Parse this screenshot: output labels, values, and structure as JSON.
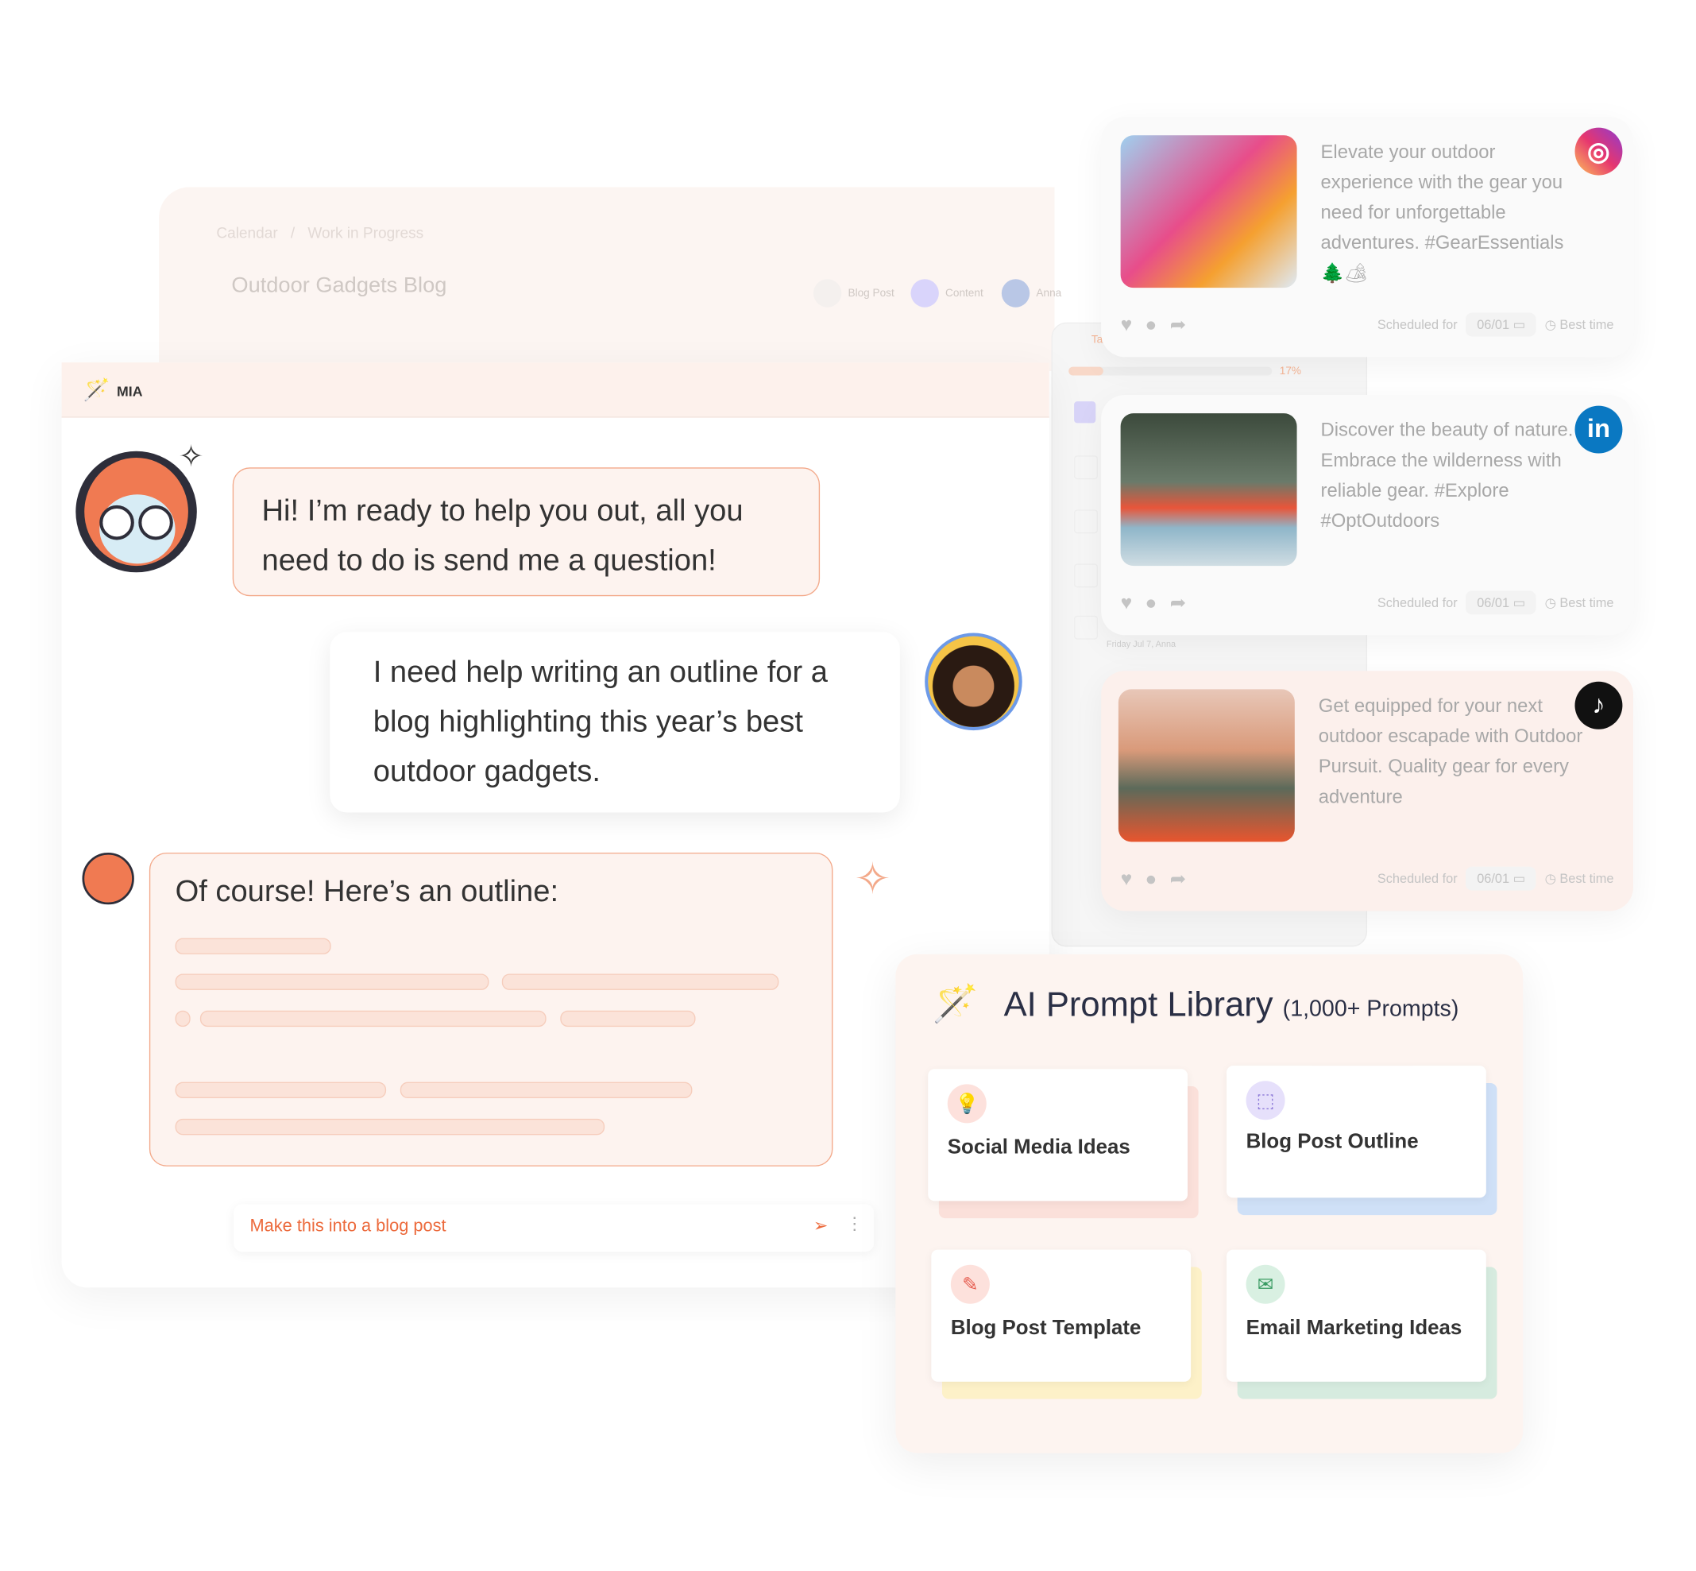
{
  "background_project": {
    "breadcrumb": [
      "Calendar",
      "/",
      "Work in Progress"
    ],
    "title": "Outdoor Gadgets Blog",
    "tags": [
      "Blog Post",
      "Content",
      "Anna"
    ],
    "task_label": "Tas",
    "progress_percent": 17,
    "progress_label": "17%",
    "task_meta": "Friday Jul 7, Anna"
  },
  "chat": {
    "assistant_name": "MIA",
    "messages": [
      {
        "from": "assistant",
        "text": "Hi! I’m ready to help you out, all you need to do is send me a question!"
      },
      {
        "from": "user",
        "text": "I need help writing an outline for a blog highlighting this year’s best outdoor gadgets."
      },
      {
        "from": "assistant",
        "text": "Of course! Here’s an outline:"
      }
    ],
    "input_value": "Make this into a blog post"
  },
  "social_posts": [
    {
      "network": "instagram-icon",
      "text": "Elevate your outdoor experience with the gear you need for unforgettable adventures. #GearEssentials 🌲🏕",
      "scheduled_label": "Scheduled for",
      "date": "06/01",
      "best_time": "Best time"
    },
    {
      "network": "linkedin-icon",
      "text": "Discover the beauty of nature. Embrace the wilderness with reliable gear. #Explore #OptOutdoors",
      "scheduled_label": "Scheduled for",
      "date": "06/01",
      "best_time": "Best time"
    },
    {
      "network": "tiktok-icon",
      "text": "Get equipped for your next outdoor escapade with Outdoor Pursuit. Quality gear for every adventure",
      "scheduled_label": "Scheduled for",
      "date": "06/01",
      "best_time": "Best time"
    }
  ],
  "prompt_library": {
    "title": "AI Prompt Library",
    "subtitle": "(1,000+ Prompts)",
    "cards": [
      {
        "label": "Social Media Ideas",
        "icon": "lightbulb-icon",
        "color": "#fbe0da"
      },
      {
        "label": "Blog Post Outline",
        "icon": "dotted-circle-icon",
        "color": "#cfe0f7"
      },
      {
        "label": "Blog Post Template",
        "icon": "edit-icon",
        "color": "#fdf1c8"
      },
      {
        "label": "Email Marketing Ideas",
        "icon": "mail-icon",
        "color": "#d6ebdf"
      }
    ]
  },
  "colors": {
    "accent": "#ec6a3c",
    "bubble_border": "#f3a98a",
    "bubble_bg": "#fdf3ef"
  }
}
